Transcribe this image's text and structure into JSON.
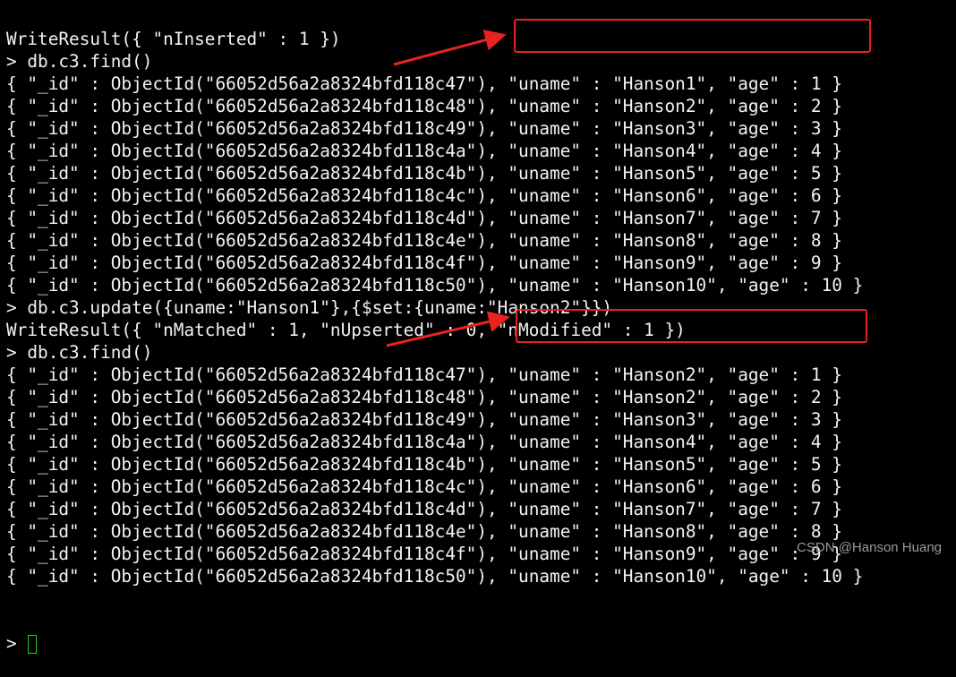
{
  "terminal": {
    "lines": [
      "WriteResult({ \"nInserted\" : 1 })",
      "> db.c3.find()",
      "{ \"_id\" : ObjectId(\"66052d56a2a8324bfd118c47\"), \"uname\" : \"Hanson1\", \"age\" : 1 }",
      "{ \"_id\" : ObjectId(\"66052d56a2a8324bfd118c48\"), \"uname\" : \"Hanson2\", \"age\" : 2 }",
      "{ \"_id\" : ObjectId(\"66052d56a2a8324bfd118c49\"), \"uname\" : \"Hanson3\", \"age\" : 3 }",
      "{ \"_id\" : ObjectId(\"66052d56a2a8324bfd118c4a\"), \"uname\" : \"Hanson4\", \"age\" : 4 }",
      "{ \"_id\" : ObjectId(\"66052d56a2a8324bfd118c4b\"), \"uname\" : \"Hanson5\", \"age\" : 5 }",
      "{ \"_id\" : ObjectId(\"66052d56a2a8324bfd118c4c\"), \"uname\" : \"Hanson6\", \"age\" : 6 }",
      "{ \"_id\" : ObjectId(\"66052d56a2a8324bfd118c4d\"), \"uname\" : \"Hanson7\", \"age\" : 7 }",
      "{ \"_id\" : ObjectId(\"66052d56a2a8324bfd118c4e\"), \"uname\" : \"Hanson8\", \"age\" : 8 }",
      "{ \"_id\" : ObjectId(\"66052d56a2a8324bfd118c4f\"), \"uname\" : \"Hanson9\", \"age\" : 9 }",
      "{ \"_id\" : ObjectId(\"66052d56a2a8324bfd118c50\"), \"uname\" : \"Hanson10\", \"age\" : 10 }",
      "> db.c3.update({uname:\"Hanson1\"},{$set:{uname:\"Hanson2\"}})",
      "WriteResult({ \"nMatched\" : 1, \"nUpserted\" : 0, \"nModified\" : 1 })",
      "> db.c3.find()",
      "{ \"_id\" : ObjectId(\"66052d56a2a8324bfd118c47\"), \"uname\" : \"Hanson2\", \"age\" : 1 }",
      "{ \"_id\" : ObjectId(\"66052d56a2a8324bfd118c48\"), \"uname\" : \"Hanson2\", \"age\" : 2 }",
      "{ \"_id\" : ObjectId(\"66052d56a2a8324bfd118c49\"), \"uname\" : \"Hanson3\", \"age\" : 3 }",
      "{ \"_id\" : ObjectId(\"66052d56a2a8324bfd118c4a\"), \"uname\" : \"Hanson4\", \"age\" : 4 }",
      "{ \"_id\" : ObjectId(\"66052d56a2a8324bfd118c4b\"), \"uname\" : \"Hanson5\", \"age\" : 5 }",
      "{ \"_id\" : ObjectId(\"66052d56a2a8324bfd118c4c\"), \"uname\" : \"Hanson6\", \"age\" : 6 }",
      "{ \"_id\" : ObjectId(\"66052d56a2a8324bfd118c4d\"), \"uname\" : \"Hanson7\", \"age\" : 7 }",
      "{ \"_id\" : ObjectId(\"66052d56a2a8324bfd118c4e\"), \"uname\" : \"Hanson8\", \"age\" : 8 }",
      "{ \"_id\" : ObjectId(\"66052d56a2a8324bfd118c4f\"), \"uname\" : \"Hanson9\", \"age\" : 9 }",
      "{ \"_id\" : ObjectId(\"66052d56a2a8324bfd118c50\"), \"uname\" : \"Hanson10\", \"age\" : 10 }"
    ],
    "prompt": ">"
  },
  "watermark": "CSDN @Hanson Huang",
  "colors": {
    "background": "#000000",
    "text": "#f2f2f2",
    "highlight": "#e8231f",
    "cursor": "#1fd11f"
  }
}
